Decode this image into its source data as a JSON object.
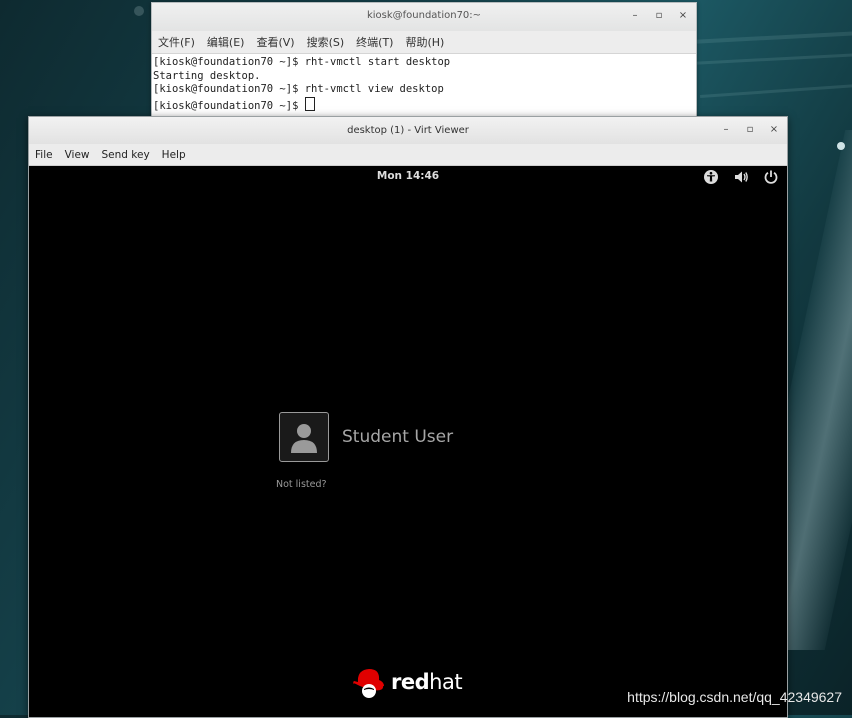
{
  "terminal": {
    "title": "kiosk@foundation70:~",
    "menu": [
      "文件(F)",
      "编辑(E)",
      "查看(V)",
      "搜索(S)",
      "终端(T)",
      "帮助(H)"
    ],
    "lines": [
      "[kiosk@foundation70 ~]$ rht-vmctl start desktop",
      "Starting desktop.",
      "[kiosk@foundation70 ~]$ rht-vmctl view desktop"
    ],
    "prompt": "[kiosk@foundation70 ~]$ "
  },
  "window_buttons": {
    "minimize": "–",
    "maximize": "▫",
    "close": "×"
  },
  "viewer": {
    "title": "desktop (1) - Virt Viewer",
    "menu": [
      "File",
      "View",
      "Send key",
      "Help"
    ]
  },
  "login": {
    "clock": "Mon 14:46",
    "tray_icons": [
      "accessibility-icon",
      "volume-icon",
      "power-icon"
    ],
    "user_name": "Student User",
    "not_listed": "Not listed?",
    "logo_text_bold": "red",
    "logo_text_thin": "hat",
    "logo_color": "#e00000"
  },
  "watermark": "https://blog.csdn.net/qq_42349627"
}
